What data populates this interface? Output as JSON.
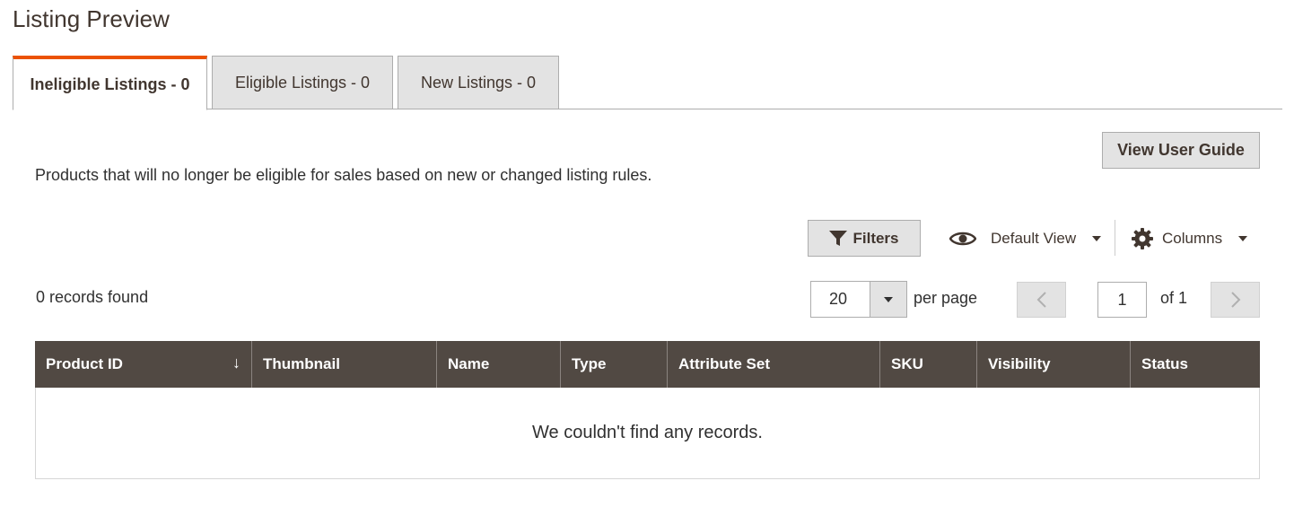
{
  "page_title": "Listing Preview",
  "tabs": [
    {
      "label": "Ineligible Listings - 0",
      "active": true
    },
    {
      "label": "Eligible Listings - 0",
      "active": false
    },
    {
      "label": "New Listings - 0",
      "active": false
    }
  ],
  "accent_color": "#eb5202",
  "header_color": "#514943",
  "guide_button": "View User Guide",
  "description": "Products that will no longer be eligible for sales based on new or changed listing rules.",
  "toolbar": {
    "filters_label": "Filters",
    "filters_icon": "funnel-icon",
    "view_label": "Default View",
    "view_icon": "eye-icon",
    "columns_label": "Columns",
    "columns_icon": "gear-icon"
  },
  "records_found": "0 records found",
  "pagination": {
    "per_page_value": "20",
    "per_page_label": "per page",
    "current_page": "1",
    "of_label": "of 1"
  },
  "table": {
    "columns": [
      "Product ID",
      "Thumbnail",
      "Name",
      "Type",
      "Attribute Set",
      "SKU",
      "Visibility",
      "Status"
    ],
    "sorted_column": "Product ID",
    "sort_indicator": "↓",
    "empty_message": "We couldn't find any records."
  }
}
